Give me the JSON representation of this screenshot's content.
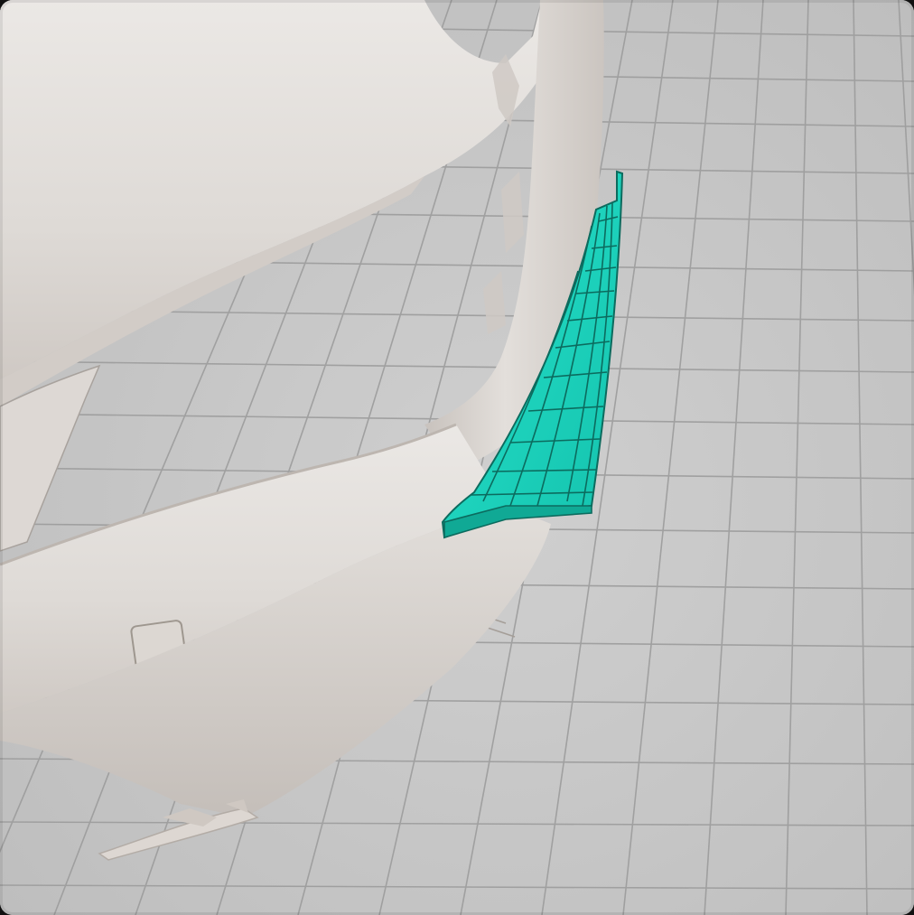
{
  "viewport": {
    "scene": "3d-scan-viewport",
    "background_color": "#c9c9c9",
    "grid_color": "#9a9a9a",
    "scan_color": "#e6e2de",
    "scan_shadow_color": "#b9b3ae",
    "highlight_surface_color": "#1fd6c0",
    "highlight_wire_color": "#0c6b5e"
  }
}
